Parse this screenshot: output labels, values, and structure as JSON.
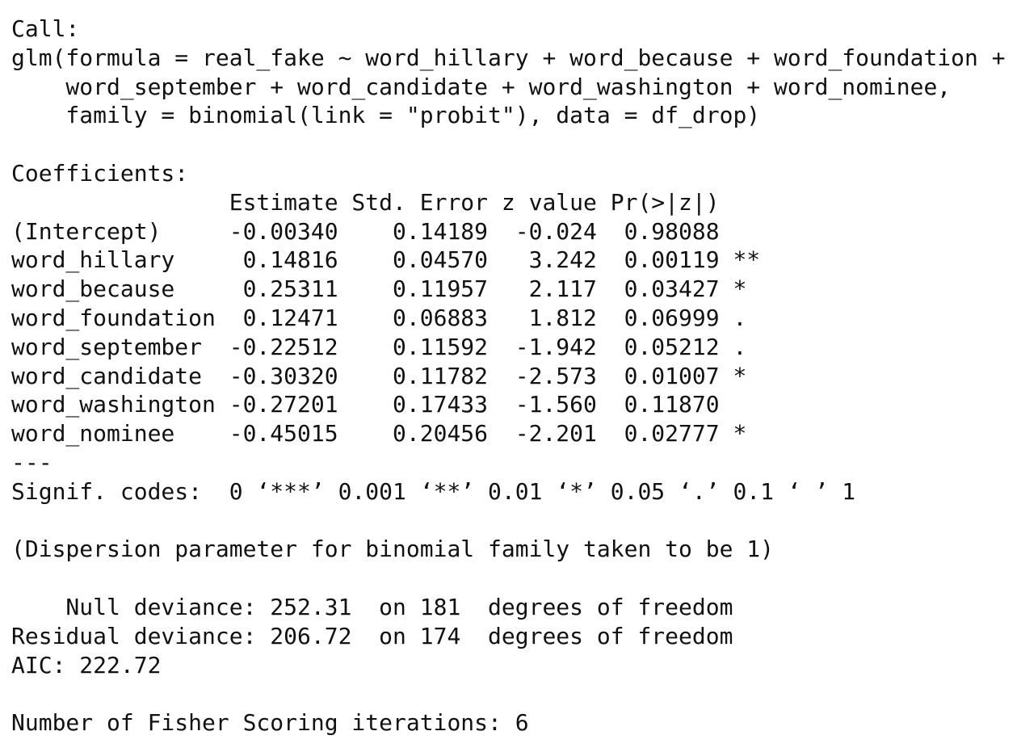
{
  "call": {
    "header": "Call:",
    "lines": [
      "glm(formula = real_fake ~ word_hillary + word_because + word_foundation +",
      "    word_september + word_candidate + word_washington + word_nominee,",
      "    family = binomial(link = \"probit\"), data = df_drop)"
    ]
  },
  "coefficients": {
    "header": "Coefficients:",
    "column_header": "                Estimate Std. Error z value Pr(>|z|)",
    "rows": [
      "(Intercept)     -0.00340    0.14189  -0.024  0.98088",
      "word_hillary     0.14816    0.04570   3.242  0.00119 **",
      "word_because     0.25311    0.11957   2.117  0.03427 *",
      "word_foundation  0.12471    0.06883   1.812  0.06999 .",
      "word_september  -0.22512    0.11592  -1.942  0.05212 .",
      "word_candidate  -0.30320    0.11782  -2.573  0.01007 *",
      "word_washington -0.27201    0.17433  -1.560  0.11870",
      "word_nominee    -0.45015    0.20456  -2.201  0.02777 *"
    ],
    "separator": "---",
    "signif_codes": "Signif. codes:  0 ‘***’ 0.001 ‘**’ 0.01 ‘*’ 0.05 ‘.’ 0.1 ‘ ’ 1"
  },
  "dispersion": "(Dispersion parameter for binomial family taken to be 1)",
  "deviance": {
    "null": "    Null deviance: 252.31  on 181  degrees of freedom",
    "residual": "Residual deviance: 206.72  on 174  degrees of freedom",
    "aic": "AIC: 222.72"
  },
  "iterations": "Number of Fisher Scoring iterations: 6"
}
